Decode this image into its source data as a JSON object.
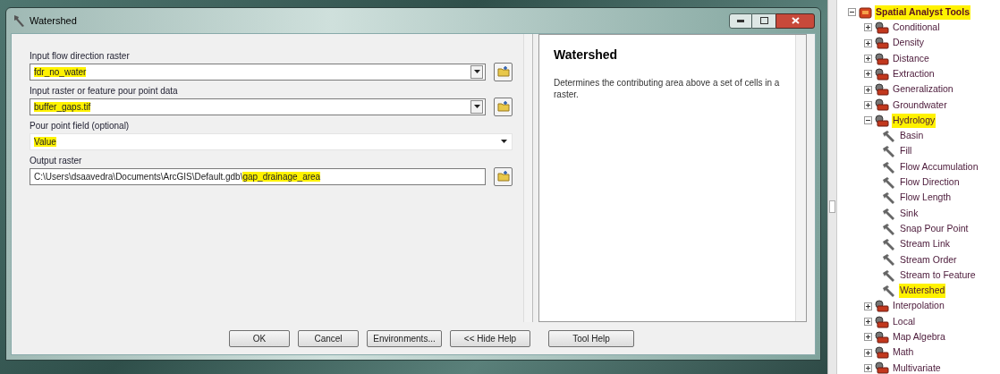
{
  "window": {
    "title": "Watershed"
  },
  "parameters": [
    {
      "label": "Input flow direction raster",
      "kind": "dropdown",
      "browse": true,
      "value_segments": [
        {
          "text": "fdr_no_water",
          "highlighted": true
        }
      ]
    },
    {
      "label": "Input raster or feature pour point data",
      "kind": "dropdown",
      "browse": true,
      "value_segments": [
        {
          "text": "buffer_gaps.tif",
          "highlighted": true
        }
      ]
    },
    {
      "label": "Pour point field (optional)",
      "kind": "combo",
      "browse": false,
      "value_segments": [
        {
          "text": "Value",
          "highlighted": true
        }
      ]
    },
    {
      "label": "Output raster",
      "kind": "text",
      "browse": true,
      "value_segments": [
        {
          "text": "C:\\Users\\dsaavedra\\Documents\\ArcGIS\\Default.gdb\\",
          "highlighted": false
        },
        {
          "text": "gap_drainage_area",
          "highlighted": true
        }
      ]
    }
  ],
  "help": {
    "title": "Watershed",
    "description": "Determines the contributing area above a set of cells in a raster."
  },
  "buttons": [
    "OK",
    "Cancel",
    "Environments...",
    "<< Hide Help"
  ],
  "help_button": "Tool Help",
  "tree": [
    {
      "label": "Spatial Analyst Tools",
      "kind": "toolbox",
      "expanded": true,
      "highlighted": true,
      "children": [
        {
          "label": "Conditional",
          "kind": "toolset",
          "expanded": false,
          "highlighted": false
        },
        {
          "label": "Density",
          "kind": "toolset",
          "expanded": false,
          "highlighted": false
        },
        {
          "label": "Distance",
          "kind": "toolset",
          "expanded": false,
          "highlighted": false
        },
        {
          "label": "Extraction",
          "kind": "toolset",
          "expanded": false,
          "highlighted": false
        },
        {
          "label": "Generalization",
          "kind": "toolset",
          "expanded": false,
          "highlighted": false
        },
        {
          "label": "Groundwater",
          "kind": "toolset",
          "expanded": false,
          "highlighted": false
        },
        {
          "label": "Hydrology",
          "kind": "toolset",
          "expanded": true,
          "highlighted": true,
          "children": [
            {
              "label": "Basin",
              "kind": "tool",
              "highlighted": false
            },
            {
              "label": "Fill",
              "kind": "tool",
              "highlighted": false
            },
            {
              "label": "Flow Accumulation",
              "kind": "tool",
              "highlighted": false
            },
            {
              "label": "Flow Direction",
              "kind": "tool",
              "highlighted": false
            },
            {
              "label": "Flow Length",
              "kind": "tool",
              "highlighted": false
            },
            {
              "label": "Sink",
              "kind": "tool",
              "highlighted": false
            },
            {
              "label": "Snap Pour Point",
              "kind": "tool",
              "highlighted": false
            },
            {
              "label": "Stream Link",
              "kind": "tool",
              "highlighted": false
            },
            {
              "label": "Stream Order",
              "kind": "tool",
              "highlighted": false
            },
            {
              "label": "Stream to Feature",
              "kind": "tool",
              "highlighted": false
            },
            {
              "label": "Watershed",
              "kind": "tool",
              "highlighted": true
            }
          ]
        },
        {
          "label": "Interpolation",
          "kind": "toolset",
          "expanded": false,
          "highlighted": false
        },
        {
          "label": "Local",
          "kind": "toolset",
          "expanded": false,
          "highlighted": false
        },
        {
          "label": "Map Algebra",
          "kind": "toolset",
          "expanded": false,
          "highlighted": false
        },
        {
          "label": "Math",
          "kind": "toolset",
          "expanded": false,
          "highlighted": false
        },
        {
          "label": "Multivariate",
          "kind": "toolset",
          "expanded": false,
          "highlighted": false
        }
      ]
    }
  ]
}
